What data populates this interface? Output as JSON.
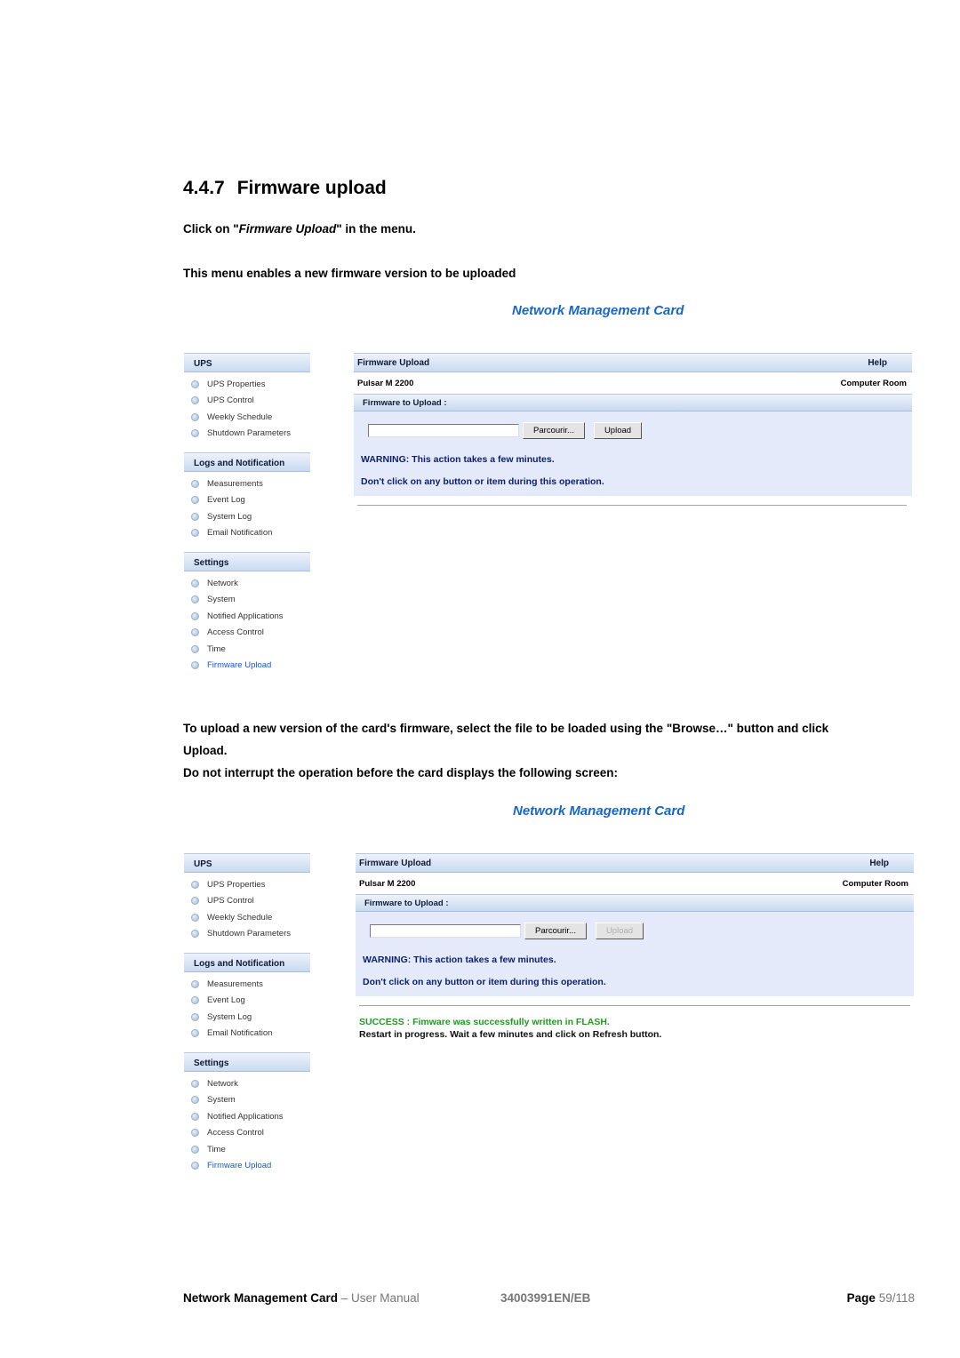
{
  "heading": {
    "number": "4.4.7",
    "title": "Firmware upload"
  },
  "intro": {
    "line1_prefix": "Click on \"",
    "line1_em": "Firmware Upload",
    "line1_suffix": "\" in the menu.",
    "line2": "This menu enables a new firmware version to be uploaded"
  },
  "instructions": {
    "line1": "To upload a new version of the card's firmware, select the file to be loaded using the \"Browse…\" button and click",
    "line2": "Upload.",
    "line3": "Do not interrupt the operation before the card displays the following screen:"
  },
  "screens": [
    {
      "app_title": "Network Management Card",
      "sidebar": [
        {
          "title": "UPS",
          "items": [
            "UPS Properties",
            "UPS Control",
            "Weekly Schedule",
            "Shutdown Parameters"
          ]
        },
        {
          "title": "Logs and Notification",
          "items": [
            "Measurements",
            "Event Log",
            "System Log",
            "Email Notification"
          ]
        },
        {
          "title": "Settings",
          "items": [
            "Network",
            "System",
            "Notified Applications",
            "Access Control",
            "Time",
            "Firmware Upload"
          ]
        }
      ],
      "active_item": "Firmware Upload",
      "page_title": "Firmware Upload",
      "help_label": "Help",
      "device_name": "Pulsar M 2200",
      "location": "Computer Room",
      "section_title": "Firmware to Upload :",
      "file_value": "",
      "browse_label": "Parcourir...",
      "upload_label": "Upload",
      "upload_disabled": false,
      "warning1": "WARNING: This action takes a few minutes.",
      "warning2": "Don't click on any button or item during this operation."
    },
    {
      "app_title": "Network Management Card",
      "sidebar": [
        {
          "title": "UPS",
          "items": [
            "UPS Properties",
            "UPS Control",
            "Weekly Schedule",
            "Shutdown Parameters"
          ]
        },
        {
          "title": "Logs and Notification",
          "items": [
            "Measurements",
            "Event Log",
            "System Log",
            "Email Notification"
          ]
        },
        {
          "title": "Settings",
          "items": [
            "Network",
            "System",
            "Notified Applications",
            "Access Control",
            "Time",
            "Firmware Upload"
          ]
        }
      ],
      "active_item": "Firmware Upload",
      "page_title": "Firmware Upload",
      "help_label": "Help",
      "device_name": "Pulsar M 2200",
      "location": "Computer Room",
      "section_title": "Firmware to Upload :",
      "file_value": "",
      "browse_label": "Parcourir...",
      "upload_label": "Upload",
      "upload_disabled": true,
      "warning1": "WARNING: This action takes a few minutes.",
      "warning2": "Don't click on any button or item during this operation.",
      "success_message": "SUCCESS : Fimware was successfully written in FLASH.",
      "restart_message": "Restart in progress. Wait a few minutes and click on Refresh button."
    }
  ],
  "footer": {
    "product": "Network Management Card",
    "separator_doc": " – User Manual",
    "doc_code": "34003991EN/EB",
    "page_label": "Page",
    "page_number": "59/118"
  },
  "colors": {
    "nmc_title": "#1a66c8",
    "warning_text": "#0a1f6e",
    "success_text": "#1f9a1f",
    "panel_bg": "#e5eafa",
    "active_link": "#1a55d0"
  }
}
